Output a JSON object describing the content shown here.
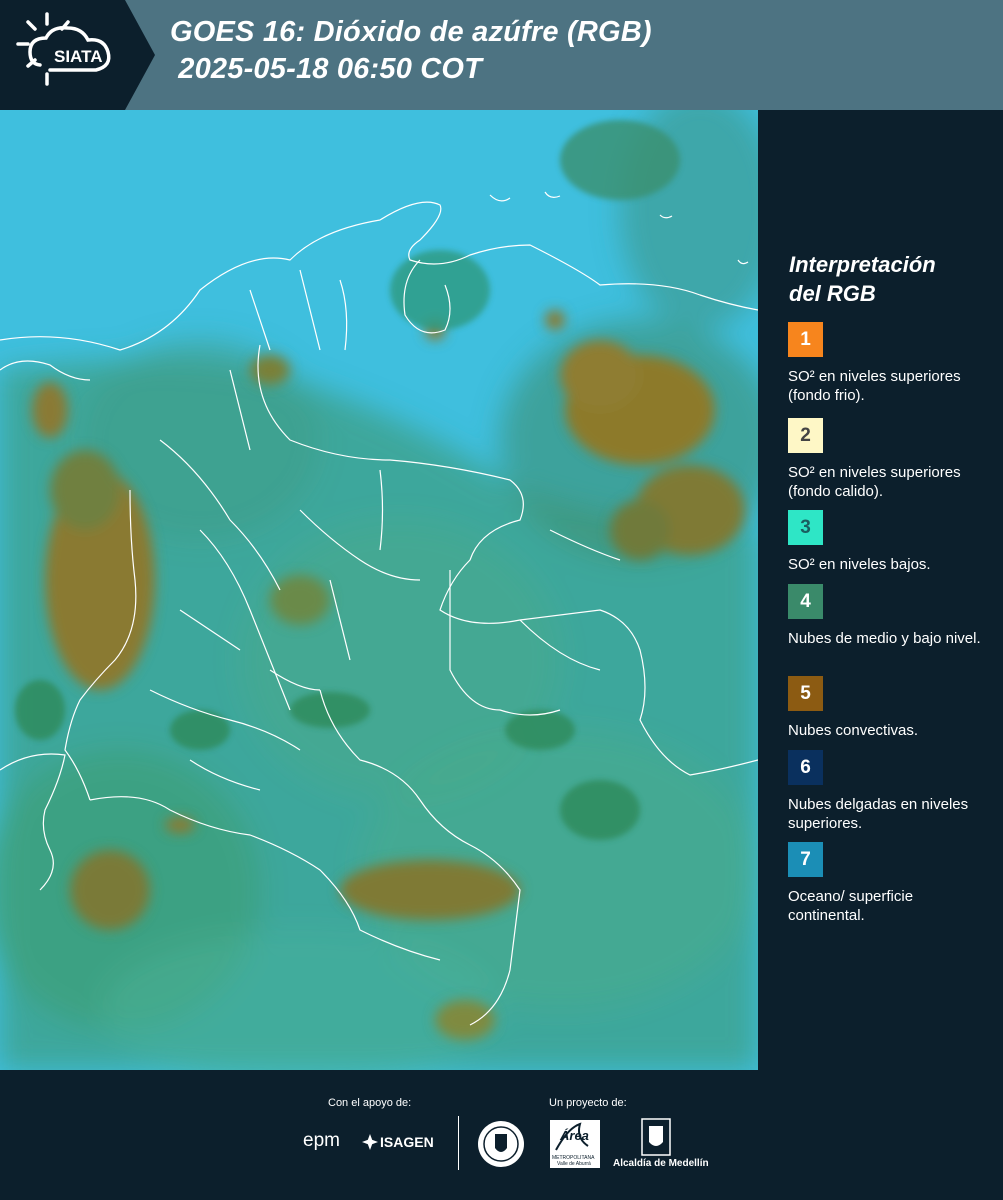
{
  "header": {
    "logo_text": "SIATA",
    "title_line1": "GOES 16: Dióxido de azúfre (RGB)",
    "title_line2": " 2025-05-18 06:50 COT",
    "logo_icon": "sun-cloud-icon"
  },
  "map": {
    "background_color": "#3fbfde",
    "cloud_colors": [
      "#8d7a2c",
      "#3f8f5f",
      "#2f9f9c"
    ],
    "border_color": "#ffffff"
  },
  "legend": {
    "title_line1": "Interpretación",
    "title_line2": "del RGB",
    "items": [
      {
        "number": "1",
        "color": "#f7851d",
        "label": "SO² en niveles superiores (fondo frio)."
      },
      {
        "number": "2",
        "color": "#fef7c6",
        "label": "SO² en niveles superiores (fondo calido)."
      },
      {
        "number": "3",
        "color": "#2ee6c6",
        "label": "SO² en niveles bajos."
      },
      {
        "number": "4",
        "color": "#3a8a6a",
        "label": "Nubes de medio y bajo nivel."
      },
      {
        "number": "5",
        "color": "#8c5b12",
        "label": "Nubes convectivas."
      },
      {
        "number": "6",
        "color": "#0a305e",
        "label": "Nubes delgadas en niveles superiores."
      },
      {
        "number": "7",
        "color": "#1b8eb6",
        "label": "Oceano/ superficie continental."
      }
    ]
  },
  "footer": {
    "support_label": "Con el apoyo de:",
    "project_label": "Un proyecto de:",
    "sponsor1": "epm",
    "sponsor2": "ISAGEN",
    "partner1_icon": "medellin-seal-icon",
    "partner2_name": "Área",
    "partner2_sub1": "METROPOLITANA",
    "partner2_sub2": "Valle de Aburrá",
    "partner3": "Alcaldía de Medellín"
  }
}
